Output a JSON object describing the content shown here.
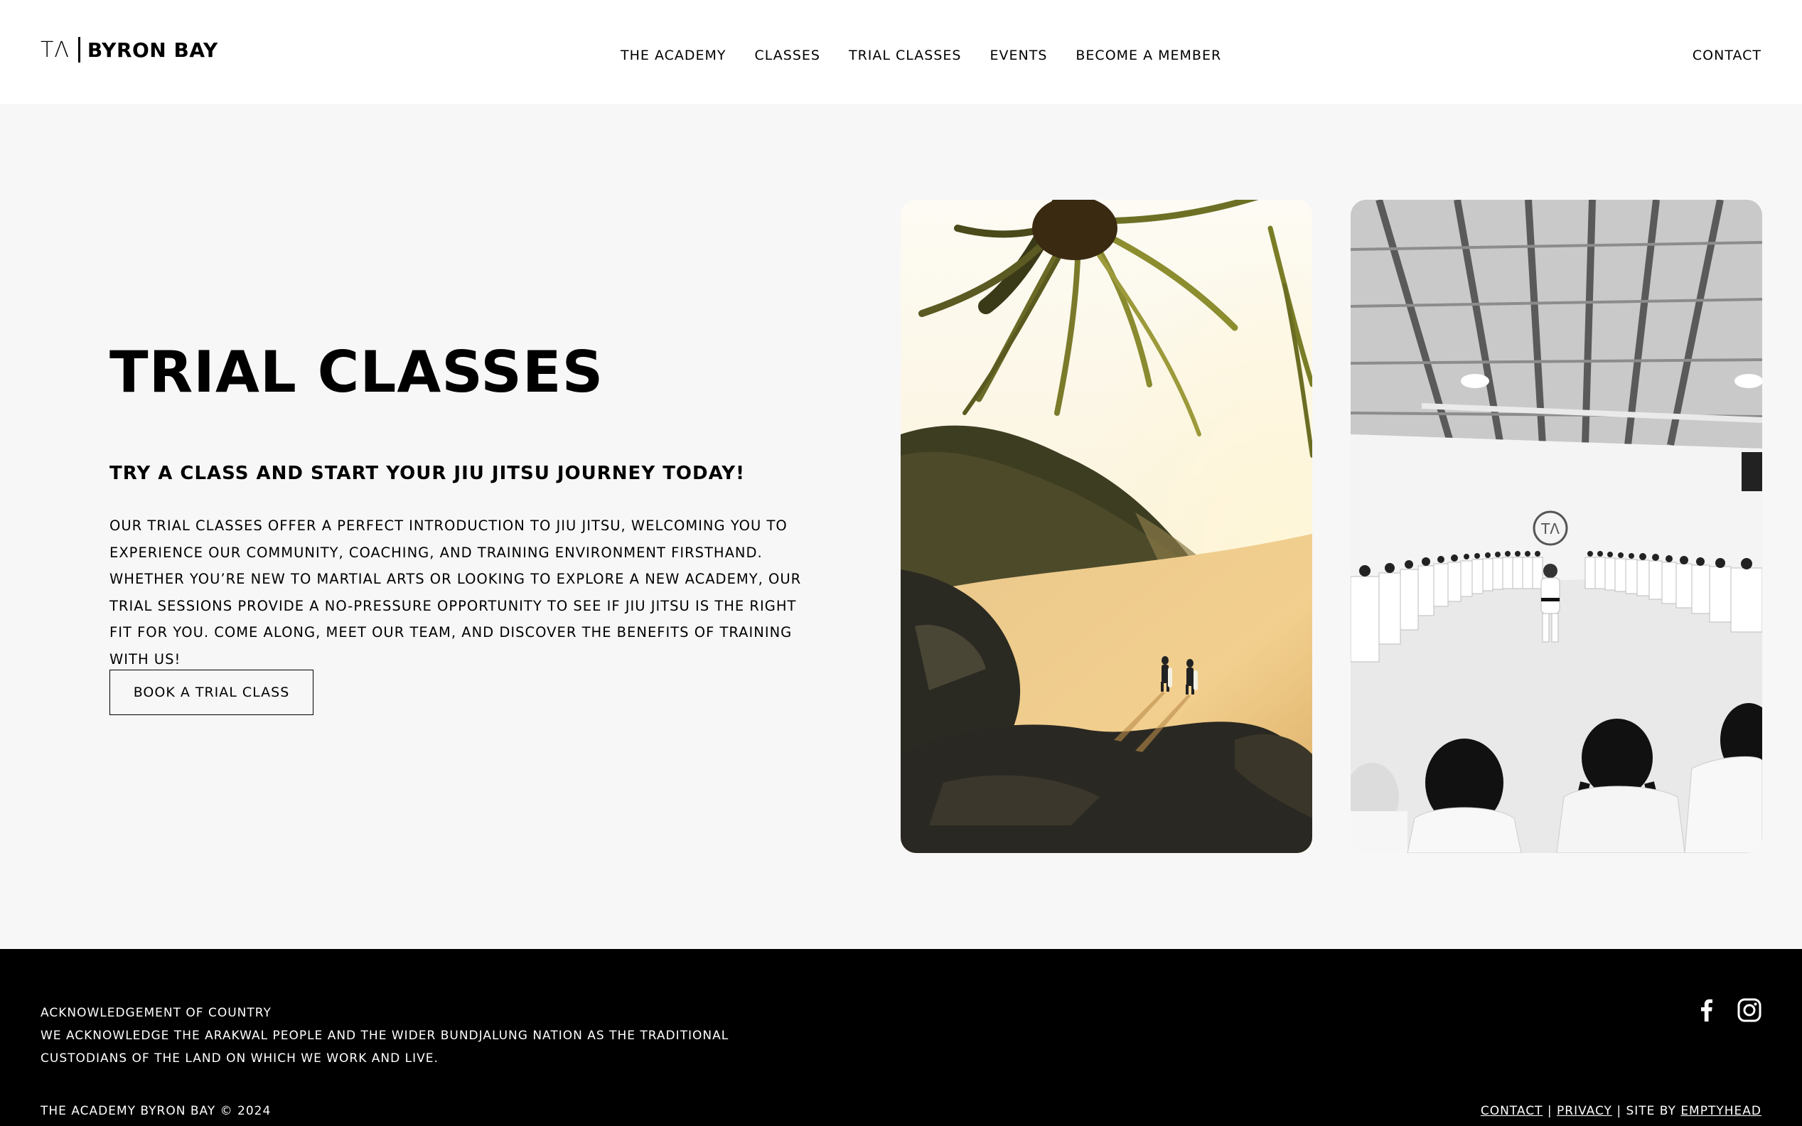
{
  "header": {
    "logo_mark": "TΛ",
    "logo_text": "BYRON BAY",
    "nav": [
      "THE ACADEMY",
      "CLASSES",
      "TRIAL CLASSES",
      "EVENTS",
      "BECOME A MEMBER"
    ],
    "contact": "CONTACT"
  },
  "main": {
    "title": "TRIAL CLASSES",
    "subtitle": "TRY A CLASS AND START YOUR JIU JITSU JOURNEY TODAY!",
    "body": "OUR TRIAL CLASSES OFFER A PERFECT INTRODUCTION TO JIU JITSU, WELCOMING YOU TO EXPERIENCE OUR COMMUNITY, COACHING, AND TRAINING ENVIRONMENT FIRSTHAND. WHETHER YOU’RE NEW TO MARTIAL ARTS OR LOOKING TO EXPLORE A NEW ACADEMY, OUR TRIAL SESSIONS PROVIDE A NO-PRESSURE OPPORTUNITY TO SEE IF JIU JITSU IS THE RIGHT FIT FOR YOU. COME ALONG, MEET OUR TEAM, AND DISCOVER THE BENEFITS OF TRAINING WITH US!",
    "cta": "BOOK A TRIAL CLASS",
    "dojo_wall_logo": "TΛ"
  },
  "footer": {
    "ack_title": "ACKNOWLEDGEMENT OF COUNTRY",
    "ack_text": "WE ACKNOWLEDGE THE ARAKWAL PEOPLE AND THE WIDER BUNDJALUNG NATION AS THE TRADITIONAL CUSTODIANS OF THE LAND ON WHICH WE WORK AND LIVE.",
    "copyright": "THE ACADEMY BYRON BAY © 2024",
    "legal": {
      "contact": "CONTACT",
      "sep": "|",
      "privacy": "PRIVACY",
      "site_by": "SITE BY",
      "agency": "EMPTYHEAD"
    },
    "social_icons": [
      "facebook-icon",
      "instagram-icon"
    ]
  },
  "colors": {
    "background": "#f7f7f7",
    "header_bg": "#ffffff",
    "footer_bg": "#000000",
    "text": "#000000"
  }
}
